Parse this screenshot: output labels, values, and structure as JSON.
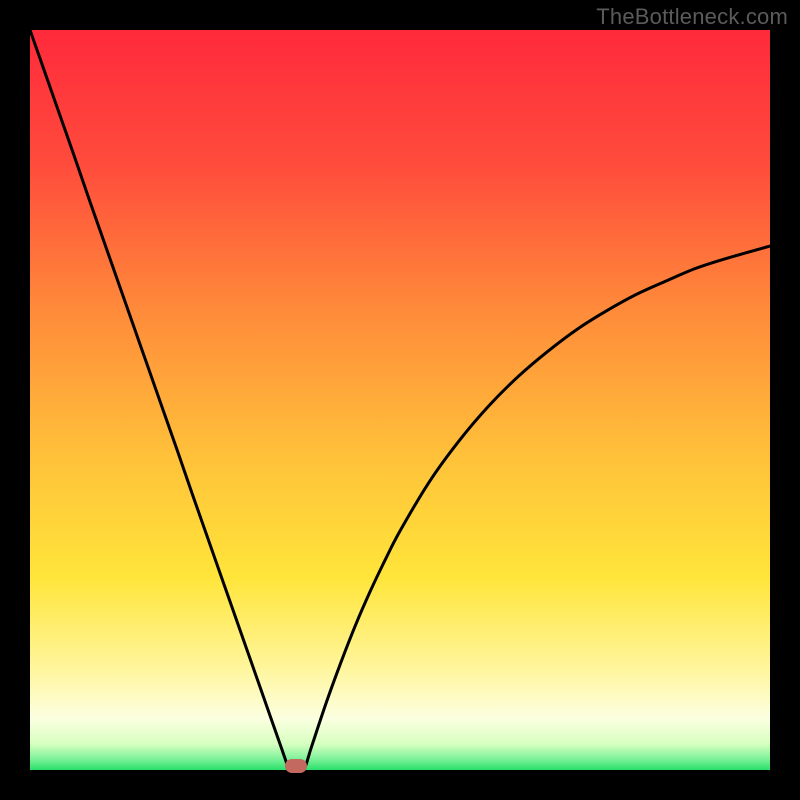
{
  "attribution": "TheBottleneck.com",
  "colors": {
    "top": "#ff2a3c",
    "mid_upper": "#ff7a3a",
    "mid": "#ffd23a",
    "mid_lower": "#fff07a",
    "band_pale": "#fdffd6",
    "bottom": "#29e06a",
    "curve": "#000000",
    "marker": "#c4695f",
    "frame": "#000000",
    "attribution_text": "#5b5b5b"
  },
  "chart_data": {
    "type": "line",
    "title": "",
    "xlabel": "",
    "ylabel": "",
    "xlim": [
      0,
      100
    ],
    "ylim": [
      0,
      100
    ],
    "x": [
      0,
      2,
      4,
      6,
      8,
      10,
      12,
      14,
      16,
      18,
      20,
      22,
      24,
      26,
      28,
      30,
      32,
      34,
      35,
      36,
      37,
      38,
      40,
      42,
      44,
      46,
      48,
      50,
      54,
      58,
      62,
      66,
      70,
      74,
      78,
      82,
      86,
      90,
      94,
      100
    ],
    "values": [
      100,
      94.3,
      88.6,
      82.9,
      77.1,
      71.4,
      65.7,
      60.0,
      54.3,
      48.6,
      42.9,
      37.1,
      31.4,
      25.7,
      20.0,
      14.3,
      8.6,
      2.9,
      0,
      0,
      0,
      3.0,
      9.0,
      14.5,
      19.6,
      24.2,
      28.4,
      32.3,
      39.0,
      44.5,
      49.2,
      53.2,
      56.6,
      59.6,
      62.1,
      64.3,
      66.1,
      67.8,
      69.1,
      70.8
    ],
    "marker": {
      "x": 36,
      "y": 0
    },
    "annotations": []
  }
}
